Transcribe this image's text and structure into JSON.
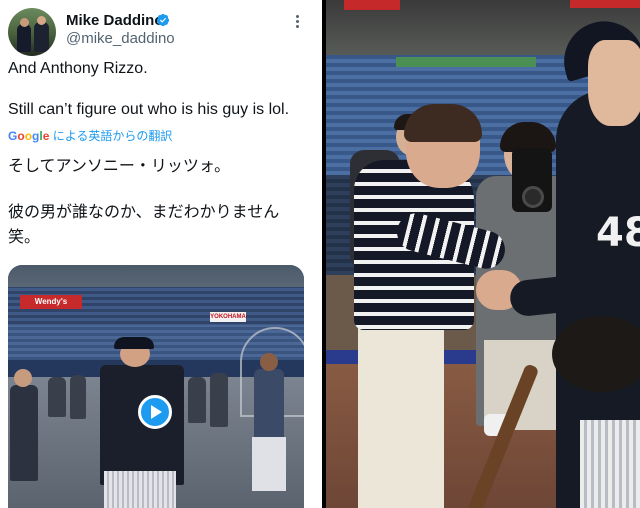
{
  "tweet": {
    "author": {
      "name": "Mike Daddino",
      "handle": "@mike_daddino",
      "verified": true
    },
    "text_line1": "And Anthony Rizzo.",
    "text_line2": "Still can’t figure out who is his guy is lol.",
    "translation_link": {
      "google_g": "G",
      "google_o1": "o",
      "google_o2": "o",
      "google_g2": "g",
      "google_l": "l",
      "google_e": "e",
      "label": "による英語からの翻訳"
    },
    "translated_line1": "そしてアンソニー・リッツォ。",
    "translated_line2": "彼の男が誰なのか、まだわかりません",
    "translated_line3": "笑。",
    "media": {
      "banner_left": "Wendy's",
      "banner_right": "YOKOHAMA"
    }
  },
  "photo": {
    "jersey_number": "48"
  },
  "colors": {
    "link": "#1d9bf0",
    "verified": "#1d9bf0",
    "text": "#0f1419",
    "secondary": "#536471"
  },
  "icons": [
    "verified-badge-icon",
    "more-options-icon",
    "play-icon"
  ]
}
